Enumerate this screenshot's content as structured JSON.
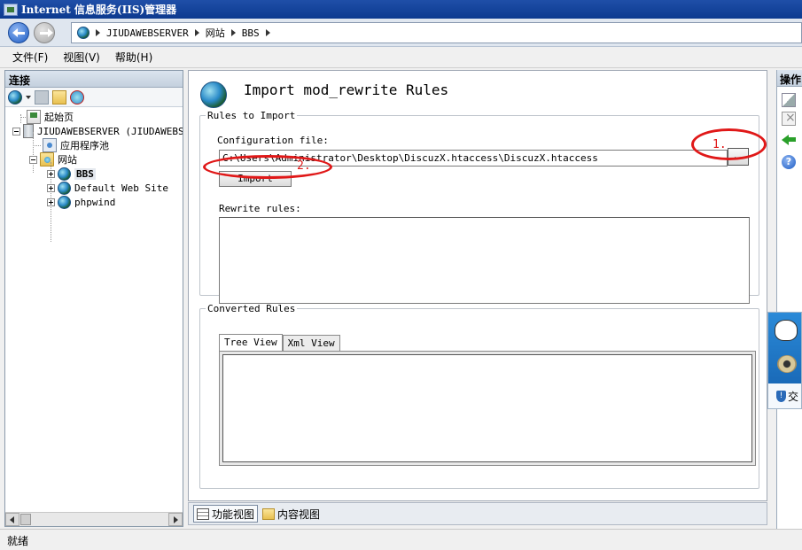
{
  "window": {
    "title": "Internet 信息服务(IIS)管理器"
  },
  "address": {
    "breadcrumb": [
      "JIUDAWEBSERVER",
      "网站",
      "BBS"
    ]
  },
  "menu": [
    "文件(F)",
    "视图(V)",
    "帮助(H)"
  ],
  "connections": {
    "header": "连接",
    "tree": {
      "start_page": "起始页",
      "server": "JIUDAWEBSERVER (JIUDAWEBSE",
      "app_pools": "应用程序池",
      "sites": "网站",
      "site_bbs": "BBS",
      "site_default": "Default Web Site",
      "site_phpwind": "phpwind"
    }
  },
  "main": {
    "title": "Import mod_rewrite Rules",
    "rules_group": {
      "legend": "Rules to Import",
      "config_label": "Configuration file:",
      "config_value": "C:\\Users\\Administrator\\Desktop\\DiscuzX.htaccess\\DiscuzX.htaccess",
      "browse_label": "..",
      "import_label": "Import",
      "rewrite_label": "Rewrite rules:"
    },
    "converted_group": {
      "legend": "Converted Rules",
      "tabs": [
        "Tree View",
        "Xml View"
      ]
    }
  },
  "annotations": {
    "one": "1.",
    "two": "2."
  },
  "view_switch": {
    "features": "功能视图",
    "content": "内容视图"
  },
  "status": {
    "text": "就绪"
  },
  "actions": {
    "header": "操作"
  },
  "float_widget": {
    "text": "交"
  },
  "colors": {
    "title_bar": "#1f4fa8",
    "annotation": "#e01818"
  }
}
